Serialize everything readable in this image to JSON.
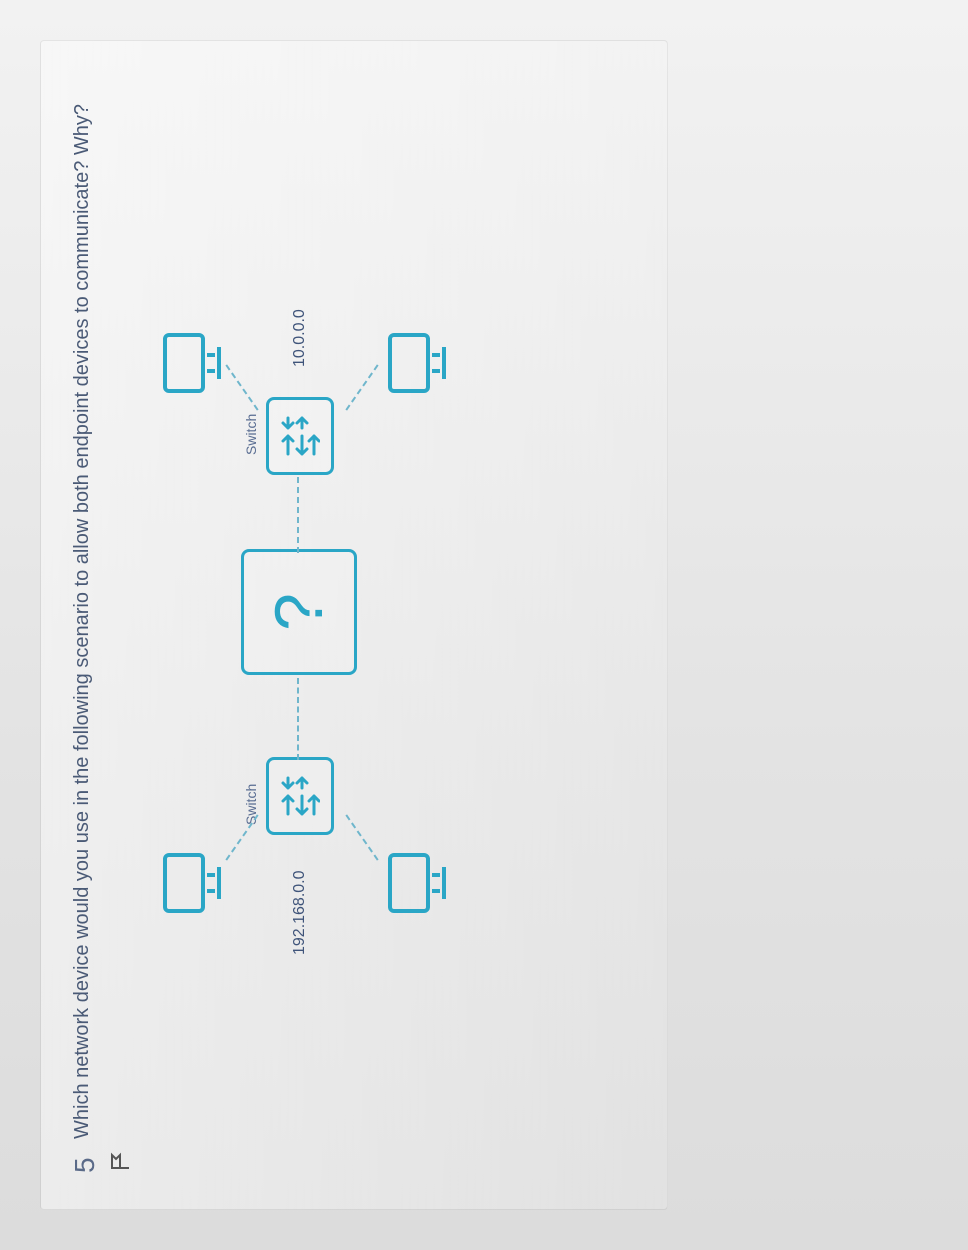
{
  "question": {
    "number": "5",
    "text": "Which network device would you use in the following scenario to allow both endpoint devices to communicate? Why?"
  },
  "flag_icon_label": "flag-icon",
  "diagram": {
    "left_net": "192.168.0.0",
    "right_net": "10.0.0.0",
    "left_switch_label": "Switch",
    "right_switch_label": "Switch",
    "mystery_label": "?"
  }
}
